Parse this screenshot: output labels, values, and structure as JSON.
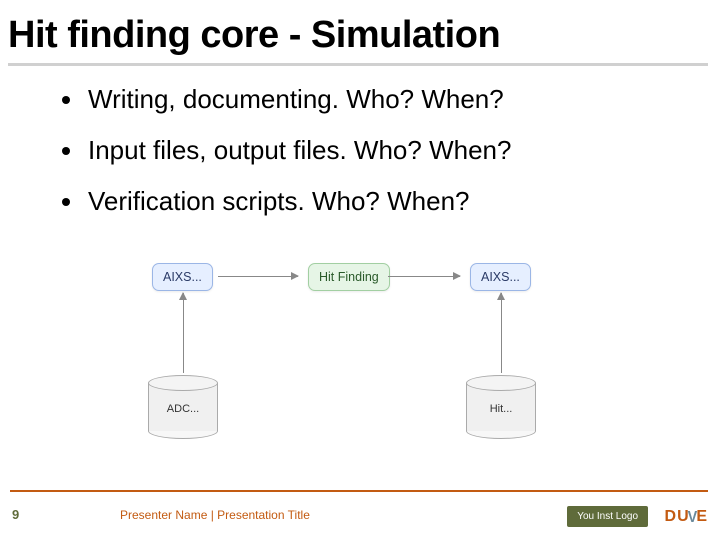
{
  "title": "Hit finding core - Simulation",
  "bullets": [
    "Writing, documenting. Who? When?",
    "Input files, output files. Who? When?",
    "Verification scripts. Who? When?"
  ],
  "diagram": {
    "nodes": {
      "aixs_left": "AIXS...",
      "hit_finding": "Hit Finding",
      "aixs_right": "AIXS...",
      "adc": "ADC...",
      "hit": "Hit..."
    }
  },
  "footer": {
    "page": "9",
    "presenter": "Presenter Name | Presentation Title",
    "inst_logo_text": "You Inst Logo",
    "brand": {
      "d": "D",
      "u": "U",
      "v": "V",
      "e": "E"
    }
  }
}
